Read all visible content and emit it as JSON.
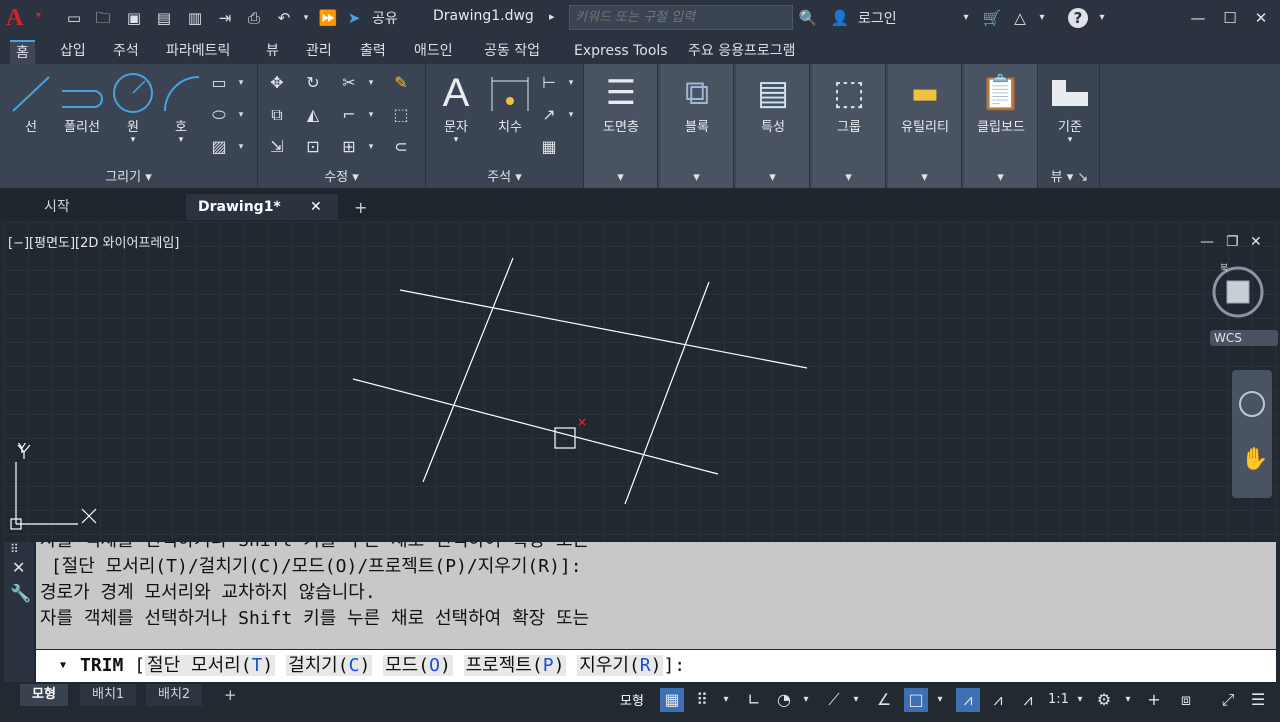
{
  "titlebar": {
    "share_label": "공유",
    "document_title": "Drawing1.dwg",
    "search_placeholder": "키워드 또는 구절 입력",
    "login_label": "로그인"
  },
  "ribbon_tabs": [
    "홈",
    "삽입",
    "주석",
    "파라메트릭",
    "뷰",
    "관리",
    "출력",
    "애드인",
    "공동 작업",
    "Express Tools",
    "주요 응용프로그램"
  ],
  "ribbon": {
    "draw": {
      "buttons": [
        "선",
        "폴리선",
        "원",
        "호"
      ],
      "label": "그리기"
    },
    "modify": {
      "label": "수정"
    },
    "annotation": {
      "buttons": [
        "문자",
        "치수"
      ],
      "label": "주석"
    },
    "layers": {
      "label": "도면층"
    },
    "block": {
      "label": "블록"
    },
    "properties": {
      "label": "특성"
    },
    "groups": {
      "label": "그룹"
    },
    "utilities": {
      "label": "유틸리티"
    },
    "clipboard": {
      "label": "클립보드"
    },
    "view": {
      "button": "기준",
      "label": "뷰"
    }
  },
  "file_tabs": [
    "시작",
    "Drawing1*"
  ],
  "viewport": {
    "label": "[−][평면도][2D 와이어프레임]",
    "viewcube_label": "WCS",
    "ucs_y": "Y"
  },
  "command": {
    "history": [
      "자를 객체를 선택하거나 Shift 키를 누른 채로 선택하여 확장 또는",
      " [절단 모서리(T)/걸치기(C)/모드(O)/프로젝트(P)/지우기(R)]:",
      "경로가 경계 모서리와 교차하지 않습니다.",
      "자를 객체를 선택하거나 Shift 키를 누른 채로 선택하여 확장 또는"
    ],
    "prompt_cmd": "TRIM",
    "options": [
      {
        "name": "절단 모서리",
        "key": "T"
      },
      {
        "name": "걸치기",
        "key": "C"
      },
      {
        "name": "모드",
        "key": "O"
      },
      {
        "name": "프로젝트",
        "key": "P"
      },
      {
        "name": "지우기",
        "key": "R"
      }
    ]
  },
  "statusbar": {
    "layout_tabs": [
      "모형",
      "배치1",
      "배치2"
    ],
    "model_label": "모형",
    "scale": "1:1"
  }
}
